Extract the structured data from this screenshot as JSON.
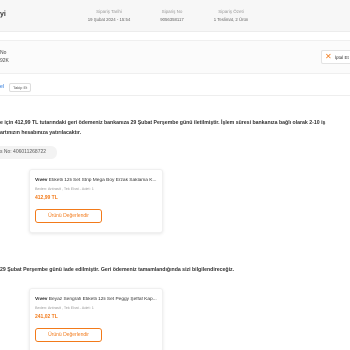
{
  "header": {
    "title": "yi",
    "order_date": {
      "label": "Sipariş Tarihi",
      "value": "19 Şubat 2024 - 15:54"
    },
    "order_no": {
      "label": "Sipariş No",
      "value": "9056358117"
    },
    "order_summary": {
      "label": "Sipariş Özeti",
      "value": "1 Teslimat, 2 Ürün"
    }
  },
  "delivery": {
    "line1": "No",
    "line2": "92K",
    "cancel_label": "İptal Et"
  },
  "tabs": {
    "active_label": "el",
    "chip_label": "Takip Et"
  },
  "refund_message": {
    "line1": "e için 412,99 TL tutarındaki geri ödemeniz bankanıza 29 Şubat Perşembe günü iletilmiştir. İşlem süresi bankanıza bağlı olarak 2-10 iş",
    "line2": "artınızın hesabınıza yatırılacaktır."
  },
  "cargo": {
    "label": "s No: 406011268722"
  },
  "products": [
    {
      "brand": "Vivev",
      "name": "Etiketli 12li Set Strip Mega Boy Erzak Saklama K...",
      "meta": "Beden: Antrasit , Tek Ebat - Adet: 1",
      "price": "412,99 TL",
      "button": "Ürünü Değerlendir"
    },
    {
      "brand": "Vivev",
      "name": "Beyaz Serigrafi Etiketli 12li Set Peggy Şeffaf Kap...",
      "meta": "Beden: Antrasit , Tek Ebat - Adet: 1",
      "price": "241,02 TL",
      "button": "Ürünü Değerlendir"
    }
  ],
  "return_message": "29 Şubat Perşembe günü iade edilmiştir. Geri ödemeniz tamamlandığında sizi bilgilendireceğiz.",
  "colors": {
    "accent": "#f27a1a",
    "link": "#1a6ed8",
    "text": "#333333",
    "muted": "#999999"
  }
}
